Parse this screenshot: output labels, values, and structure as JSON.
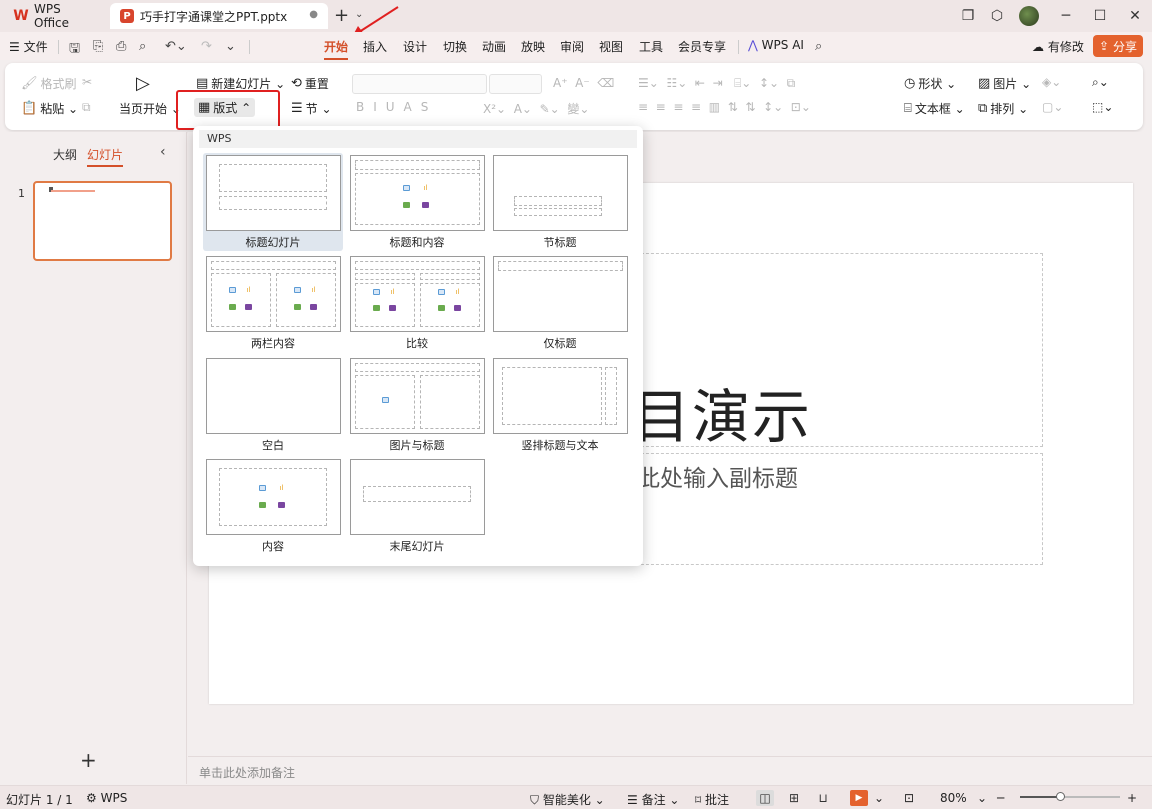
{
  "titlebar": {
    "app_tab": "WPS Office",
    "doc_tab": "巧手打字通课堂之PPT.pptx"
  },
  "menu": {
    "file": "文件",
    "tabs": [
      "开始",
      "插入",
      "设计",
      "切换",
      "动画",
      "放映",
      "审阅",
      "视图",
      "工具",
      "会员专享"
    ],
    "wps_ai": "WPS AI",
    "modified": "有修改",
    "share": "分享"
  },
  "ribbon": {
    "format_painter": "格式刷",
    "paste": "粘贴",
    "start_from_current": "当页开始",
    "new_slide": "新建幻灯片",
    "reset": "重置",
    "layout": "版式",
    "section": "节",
    "shape": "形状",
    "picture": "图片",
    "textbox": "文本框",
    "arrange": "排列"
  },
  "left_panel": {
    "tab_outline": "大纲",
    "tab_slides": "幻灯片",
    "thumb_number": "1"
  },
  "layout_dropdown": {
    "header": "WPS",
    "layouts": [
      {
        "label": "标题幻灯片",
        "selected": true
      },
      {
        "label": "标题和内容"
      },
      {
        "label": "节标题"
      },
      {
        "label": "两栏内容"
      },
      {
        "label": "比较"
      },
      {
        "label": "仅标题"
      },
      {
        "label": "空白"
      },
      {
        "label": "图片与标题"
      },
      {
        "label": "竖排标题与文本"
      },
      {
        "label": "内容"
      },
      {
        "label": "末尾幻灯片"
      }
    ]
  },
  "slide": {
    "title_visible": "目演示",
    "subtitle_visible": "此处输入副标题"
  },
  "notes": {
    "placeholder": "单击此处添加备注"
  },
  "statusbar": {
    "slide_count": "幻灯片 1 / 1",
    "theme": "WPS",
    "smart_beautify": "智能美化",
    "notes": "备注",
    "comments": "批注",
    "zoom": "80%",
    "zoom_level": 0.4
  },
  "colors": {
    "accent": "#d4502a",
    "share": "#e4622e",
    "highlight_box": "#e02020"
  }
}
